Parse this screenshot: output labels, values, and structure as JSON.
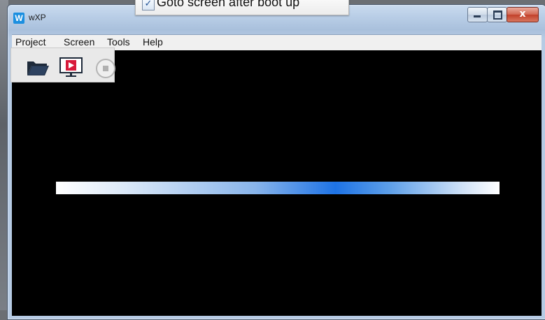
{
  "window": {
    "title": "wXP",
    "app_icon_letter": "W"
  },
  "menu": {
    "items": [
      "Project",
      "Screen",
      "Tools",
      "Help"
    ]
  },
  "toolbar": {
    "buttons": [
      "open-folder-icon",
      "play-screen-icon",
      "stop-icon"
    ]
  },
  "boot_progress": {
    "style": "indeterminate-gradient",
    "accent": "#1e73e6"
  },
  "overlay": {
    "checkbox_label": "Goto screen after boot up",
    "checked": true,
    "check_glyph": "✓"
  },
  "caption_buttons": {
    "close_glyph": "x"
  },
  "colors": {
    "client_bg": "#000000",
    "close_button": "#c2402a"
  }
}
